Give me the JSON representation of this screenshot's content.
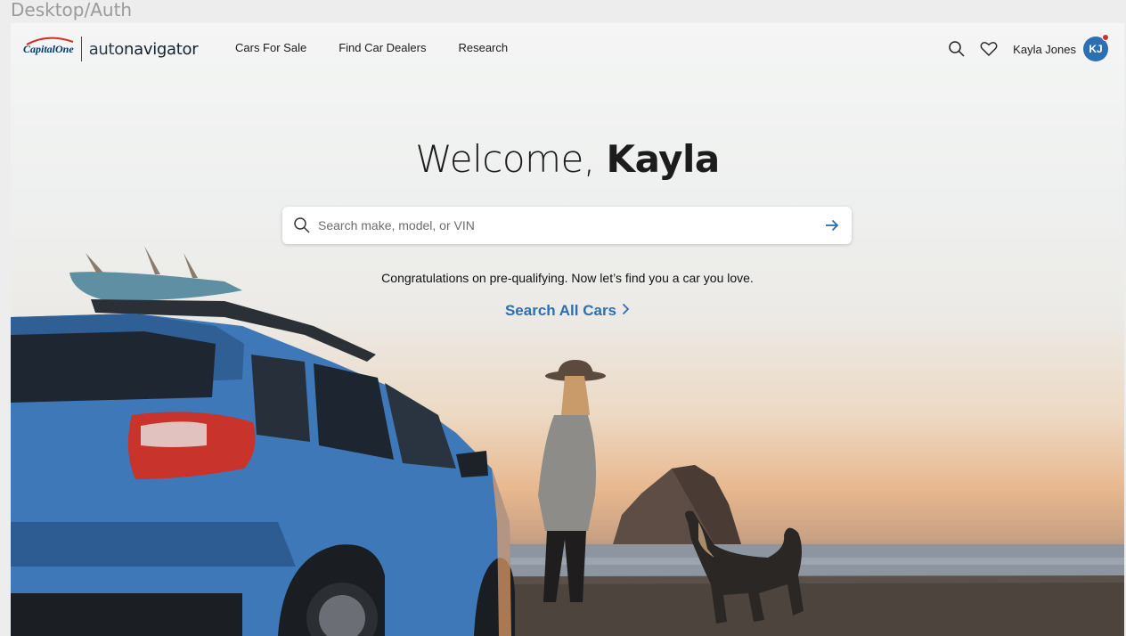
{
  "frame_label": "Desktop/Auth",
  "brand": {
    "capital": "Capital",
    "one": "One",
    "auto": "auto",
    "navigator": "navigator"
  },
  "nav": {
    "items": [
      {
        "label": "Cars For Sale"
      },
      {
        "label": "Find Car Dealers"
      },
      {
        "label": "Research"
      }
    ]
  },
  "header_right": {
    "search_icon": "search-icon",
    "favorites_icon": "heart-icon",
    "user_name": "Kayla Jones",
    "avatar_initials": "KJ",
    "notification": true
  },
  "hero": {
    "welcome_prefix": "Welcome,",
    "welcome_name": "Kayla",
    "search_placeholder": "Search make, model, or VIN",
    "congrats": "Congratulations on pre-qualifying. Now let’s find you a car you love.",
    "search_all_label": "Search All Cars"
  },
  "colors": {
    "accent": "#2c6fb3",
    "brand_navy": "#003a6f",
    "notification": "#d62b2b"
  }
}
